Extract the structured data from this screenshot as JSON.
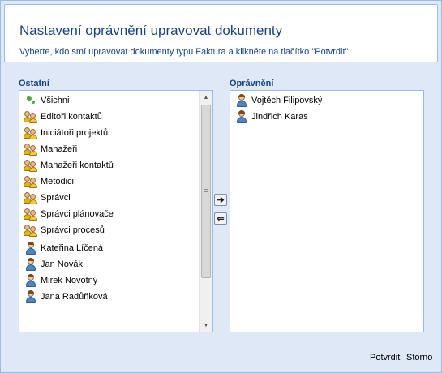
{
  "dialog": {
    "title": "Nastavení oprávnění upravovat dokumenty",
    "subtitle": "Vyberte, kdo smí upravovat dokumenty typu Faktura a klikněte na tlačítko \"Potvrdit\""
  },
  "available": {
    "label": "Ostatní",
    "items": [
      {
        "label": "Všichni",
        "icon": "globe-icon"
      },
      {
        "label": "Editoři kontaktů",
        "icon": "group-icon"
      },
      {
        "label": "Iniciátoři projektů",
        "icon": "group-icon"
      },
      {
        "label": "Manažeři",
        "icon": "group-icon"
      },
      {
        "label": "Manažeři kontaktů",
        "icon": "group-icon"
      },
      {
        "label": "Metodici",
        "icon": "group-icon"
      },
      {
        "label": "Správci",
        "icon": "group-icon"
      },
      {
        "label": "Správci plánovače",
        "icon": "group-icon"
      },
      {
        "label": "Správci procesů",
        "icon": "group-icon"
      },
      {
        "label": "Kateřina Líčená",
        "icon": "user-icon"
      },
      {
        "label": "Jan Novák",
        "icon": "user-icon"
      },
      {
        "label": "Mirek Novotný",
        "icon": "user-icon"
      },
      {
        "label": "Jana Radůňková",
        "icon": "user-icon"
      }
    ]
  },
  "assigned": {
    "label": "Oprávnění",
    "items": [
      {
        "label": "Vojtěch Filipovský",
        "icon": "user-icon"
      },
      {
        "label": "Jindřich Karas",
        "icon": "user-icon"
      }
    ]
  },
  "transfer": {
    "add_glyph": "➔",
    "remove_glyph": "⇐"
  },
  "footer": {
    "confirm_label": "Potvrdit",
    "cancel_label": "Storno"
  },
  "colors": {
    "accent": "#15428b",
    "panel_background": "#dfe8f6",
    "border": "#99bbe8"
  }
}
